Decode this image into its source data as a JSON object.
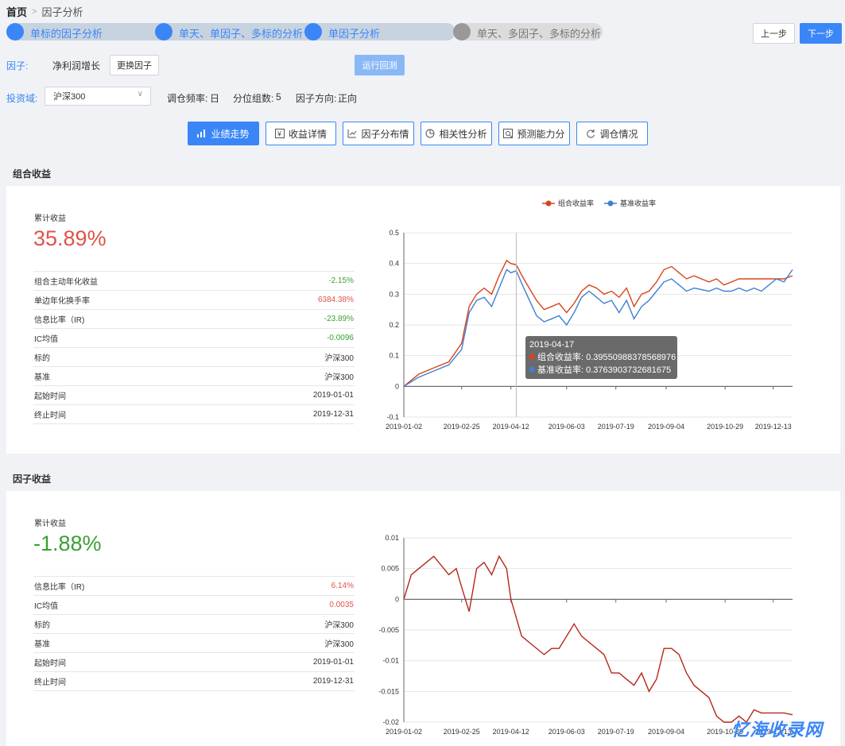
{
  "breadcrumb": {
    "home": "首页",
    "separator": ">",
    "current": "因子分析"
  },
  "steps": [
    {
      "label": "单标的因子分析",
      "state": "active"
    },
    {
      "label": "单天、单因子、多标的分析",
      "state": "active"
    },
    {
      "label": "单因子分析",
      "state": "active"
    },
    {
      "label": "单天、多因子、多标的分析",
      "state": "inactive"
    }
  ],
  "nav": {
    "prev_label": "上一步",
    "next_label": "下一步"
  },
  "factor": {
    "label": "因子:",
    "value": "净利润增长",
    "change_label": "更换因子",
    "run_label": "运行回测"
  },
  "universe": {
    "label": "投资域:",
    "selected": "沪深300",
    "freq_label": "调仓频率:",
    "freq_value": "日",
    "groups_label": "分位组数:",
    "groups_value": "5",
    "direction_label": "因子方向:",
    "direction_value": "正向"
  },
  "tabs": [
    {
      "label": "业绩走势",
      "icon": "bar-chart-icon",
      "active": true
    },
    {
      "label": "收益详情",
      "icon": "yen-icon",
      "active": false
    },
    {
      "label": "因子分布情",
      "icon": "line-chart-icon",
      "active": false
    },
    {
      "label": "相关性分析",
      "icon": "pie-chart-icon",
      "active": false
    },
    {
      "label": "预测能力分",
      "icon": "forecast-icon",
      "active": false
    },
    {
      "label": "调仓情况",
      "icon": "refresh-icon",
      "active": false
    }
  ],
  "portfolio": {
    "title": "组合收益",
    "cum_label": "累计收益",
    "cum_value": "35.89%",
    "rows": [
      {
        "label": "组合主动年化收益",
        "value": "-2.15%",
        "color": "green"
      },
      {
        "label": "单边年化换手率",
        "value": "6384.38%",
        "color": "red"
      },
      {
        "label": "信息比率（IR)",
        "value": "-23.89%",
        "color": "green"
      },
      {
        "label": "IC均值",
        "value": "-0.0096",
        "color": "green"
      },
      {
        "label": "标的",
        "value": "沪深300",
        "color": "normal"
      },
      {
        "label": "基准",
        "value": "沪深300",
        "color": "normal"
      },
      {
        "label": "起始时间",
        "value": "2019-01-01",
        "color": "normal"
      },
      {
        "label": "终止时间",
        "value": "2019-12-31",
        "color": "normal"
      }
    ]
  },
  "factor_panel": {
    "title": "因子收益",
    "cum_label": "累计收益",
    "cum_value": "-1.88%",
    "rows": [
      {
        "label": "信息比率（IR)",
        "value": "6.14%",
        "color": "red"
      },
      {
        "label": "IC均值",
        "value": "0.0035",
        "color": "red"
      },
      {
        "label": "标的",
        "value": "沪深300",
        "color": "normal"
      },
      {
        "label": "基准",
        "value": "沪深300",
        "color": "normal"
      },
      {
        "label": "起始时间",
        "value": "2019-01-01",
        "color": "normal"
      },
      {
        "label": "终止时间",
        "value": "2019-12-31",
        "color": "normal"
      }
    ]
  },
  "chart_data": [
    {
      "type": "line",
      "legend_position": "top",
      "grid": true,
      "ylim": [
        -0.1,
        0.5
      ],
      "yticks": [
        "-0.1",
        "0",
        "0.1",
        "0.2",
        "0.3",
        "0.4",
        "0.5"
      ],
      "xticks": [
        "2019-01-02",
        "2019-02-25",
        "2019-04-12",
        "2019-06-03",
        "2019-07-19",
        "2019-09-04",
        "2019-10-29",
        "2019-12-13"
      ],
      "x": [
        "2019-01-02",
        "2019-01-16",
        "2019-01-30",
        "2019-02-13",
        "2019-02-25",
        "2019-03-04",
        "2019-03-11",
        "2019-03-18",
        "2019-03-25",
        "2019-04-01",
        "2019-04-08",
        "2019-04-12",
        "2019-04-17",
        "2019-04-24",
        "2019-05-06",
        "2019-05-13",
        "2019-05-20",
        "2019-05-27",
        "2019-06-03",
        "2019-06-10",
        "2019-06-17",
        "2019-06-24",
        "2019-07-01",
        "2019-07-08",
        "2019-07-15",
        "2019-07-22",
        "2019-07-29",
        "2019-08-05",
        "2019-08-12",
        "2019-08-19",
        "2019-08-26",
        "2019-09-02",
        "2019-09-09",
        "2019-09-16",
        "2019-09-23",
        "2019-09-30",
        "2019-10-14",
        "2019-10-21",
        "2019-10-28",
        "2019-11-04",
        "2019-11-11",
        "2019-11-18",
        "2019-11-25",
        "2019-12-02",
        "2019-12-09",
        "2019-12-16",
        "2019-12-23",
        "2019-12-31"
      ],
      "series": [
        {
          "name": "组合收益率",
          "color": "#d9441c",
          "values": [
            0.0,
            0.04,
            0.06,
            0.08,
            0.14,
            0.26,
            0.3,
            0.32,
            0.3,
            0.36,
            0.41,
            0.4,
            0.3955,
            0.35,
            0.28,
            0.25,
            0.26,
            0.27,
            0.24,
            0.27,
            0.31,
            0.33,
            0.32,
            0.3,
            0.31,
            0.29,
            0.32,
            0.26,
            0.3,
            0.31,
            0.34,
            0.38,
            0.39,
            0.37,
            0.35,
            0.36,
            0.34,
            0.35,
            0.33,
            0.34,
            0.35,
            0.35,
            0.35,
            0.35,
            0.35,
            0.35,
            0.35,
            0.36
          ]
        },
        {
          "name": "基准收益率",
          "color": "#3f7fd4",
          "values": [
            0.0,
            0.03,
            0.05,
            0.07,
            0.12,
            0.24,
            0.28,
            0.29,
            0.26,
            0.32,
            0.38,
            0.37,
            0.3764,
            0.32,
            0.23,
            0.21,
            0.22,
            0.23,
            0.2,
            0.24,
            0.29,
            0.31,
            0.29,
            0.27,
            0.28,
            0.24,
            0.28,
            0.22,
            0.26,
            0.28,
            0.31,
            0.34,
            0.35,
            0.33,
            0.31,
            0.32,
            0.31,
            0.32,
            0.31,
            0.31,
            0.32,
            0.31,
            0.32,
            0.31,
            0.33,
            0.35,
            0.34,
            0.38
          ]
        }
      ],
      "tooltip": {
        "date": "2019-04-17",
        "items": [
          {
            "name": "组合收益率",
            "value": "0.39550988378568976"
          },
          {
            "name": "基准收益率",
            "value": "0.3763903732681675"
          }
        ]
      }
    },
    {
      "type": "line",
      "grid": true,
      "ylim": [
        -0.02,
        0.01
      ],
      "yticks": [
        "-0.02",
        "-0.015",
        "-0.01",
        "-0.005",
        "0",
        "0.005",
        "0.01"
      ],
      "xticks": [
        "2019-01-02",
        "2019-02-25",
        "2019-04-12",
        "2019-06-03",
        "2019-07-19",
        "2019-09-04",
        "2019-10-29",
        "2019-12-13"
      ],
      "x": [
        "2019-01-02",
        "2019-01-09",
        "2019-01-16",
        "2019-01-23",
        "2019-01-30",
        "2019-02-13",
        "2019-02-20",
        "2019-02-25",
        "2019-03-04",
        "2019-03-11",
        "2019-03-18",
        "2019-03-25",
        "2019-04-01",
        "2019-04-08",
        "2019-04-12",
        "2019-04-22",
        "2019-04-29",
        "2019-05-13",
        "2019-05-20",
        "2019-05-27",
        "2019-06-03",
        "2019-06-10",
        "2019-06-17",
        "2019-06-24",
        "2019-07-01",
        "2019-07-08",
        "2019-07-15",
        "2019-07-22",
        "2019-07-29",
        "2019-08-05",
        "2019-08-12",
        "2019-08-19",
        "2019-08-26",
        "2019-09-02",
        "2019-09-09",
        "2019-09-16",
        "2019-09-23",
        "2019-09-30",
        "2019-10-14",
        "2019-10-21",
        "2019-10-28",
        "2019-11-04",
        "2019-11-11",
        "2019-11-18",
        "2019-11-25",
        "2019-12-02",
        "2019-12-09",
        "2019-12-16",
        "2019-12-23",
        "2019-12-31"
      ],
      "series": [
        {
          "name": "因子收益",
          "color": "#b5261c",
          "values": [
            0.0,
            0.004,
            0.005,
            0.006,
            0.007,
            0.004,
            0.005,
            0.002,
            -0.002,
            0.005,
            0.006,
            0.004,
            0.007,
            0.005,
            0.0,
            -0.006,
            -0.007,
            -0.009,
            -0.008,
            -0.008,
            -0.006,
            -0.004,
            -0.006,
            -0.007,
            -0.008,
            -0.009,
            -0.012,
            -0.012,
            -0.013,
            -0.014,
            -0.012,
            -0.015,
            -0.013,
            -0.008,
            -0.008,
            -0.009,
            -0.012,
            -0.014,
            -0.016,
            -0.019,
            -0.02,
            -0.02,
            -0.019,
            -0.02,
            -0.018,
            -0.0185,
            -0.0185,
            -0.0185,
            -0.0185,
            -0.0188
          ]
        }
      ]
    }
  ],
  "watermark": "忆海收录网"
}
